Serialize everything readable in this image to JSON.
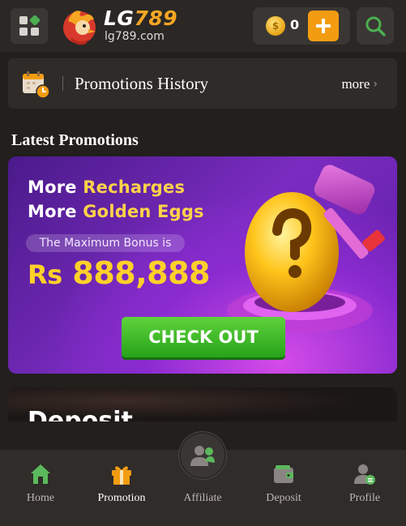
{
  "header": {
    "logo_name": "LG",
    "logo_number": "789",
    "logo_domain": "lg789.com",
    "balance": "0",
    "icons": {
      "menu": "grid-menu-icon",
      "coin": "coin-icon",
      "add": "plus-icon",
      "search": "search-icon"
    },
    "colors": {
      "accent": "#f39c12",
      "menu_green": "#4caf50"
    }
  },
  "history": {
    "title": "Promotions History",
    "more_label": "more",
    "icon": "calendar-clock-icon"
  },
  "latest": {
    "title": "Latest Promotions"
  },
  "banner": {
    "line1_a": "More ",
    "line1_b": "Recharges",
    "line2_a": "More ",
    "line2_b": "Golden Eggs",
    "bonus_label": "The Maximum Bonus is",
    "currency": "Rs",
    "amount": "888,888",
    "cta_label": "CHECK OUT",
    "art": "golden-egg-hammer-icon",
    "colors": {
      "gold": "#ffd02a",
      "cta_green": "#3cbc28",
      "purple": "#7a2cc0"
    }
  },
  "next_card": {
    "title": "Deposit"
  },
  "bottom_nav": {
    "items": [
      {
        "label": "Home",
        "icon": "home-icon"
      },
      {
        "label": "Promotion",
        "icon": "gift-icon"
      },
      {
        "label": "Affiliate",
        "icon": "affiliate-users-icon"
      },
      {
        "label": "Deposit",
        "icon": "wallet-icon"
      },
      {
        "label": "Profile",
        "icon": "profile-icon"
      }
    ],
    "active_index": 1,
    "colors": {
      "home": "#5cb85c",
      "promotion": "#f39c12",
      "inactive": "#8a8582"
    }
  }
}
